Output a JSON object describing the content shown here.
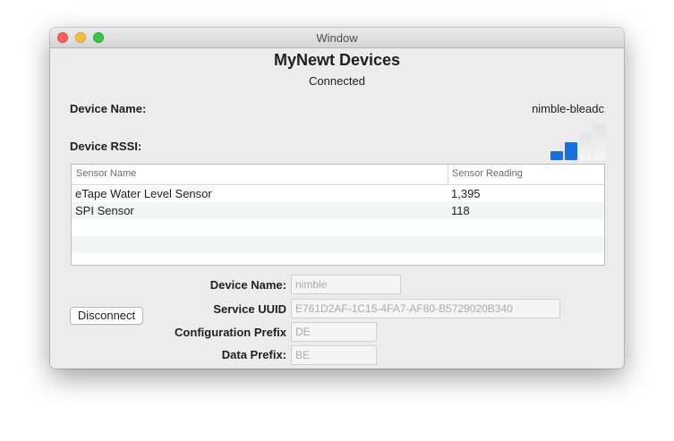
{
  "window": {
    "title": "Window"
  },
  "header": {
    "title": "MyNewt Devices",
    "status": "Connected"
  },
  "device": {
    "name_label": "Device Name:",
    "name_value": "nimble-bleadc",
    "rssi_label": "Device RSSI:",
    "rssi_bars_active": 2,
    "rssi_bars_total": 4
  },
  "table": {
    "columns": [
      "Sensor Name",
      "Sensor Reading"
    ],
    "rows": [
      {
        "name": "eTape Water Level Sensor",
        "reading": "1,395"
      },
      {
        "name": "SPI Sensor",
        "reading": "118"
      }
    ]
  },
  "form": {
    "disconnect_label": "Disconnect",
    "device_name_label": "Device Name:",
    "device_name_placeholder": "nimble",
    "service_uuid_label": "Service UUID",
    "service_uuid_placeholder": "E761D2AF-1C15-4FA7-AF80-B5729020B340",
    "config_prefix_label": "Configuration Prefix",
    "config_prefix_placeholder": "DE",
    "data_prefix_label": "Data Prefix:",
    "data_prefix_placeholder": "BE"
  },
  "colors": {
    "signal_active": "#1a6fde",
    "signal_inactive": "#e3e3e3"
  }
}
